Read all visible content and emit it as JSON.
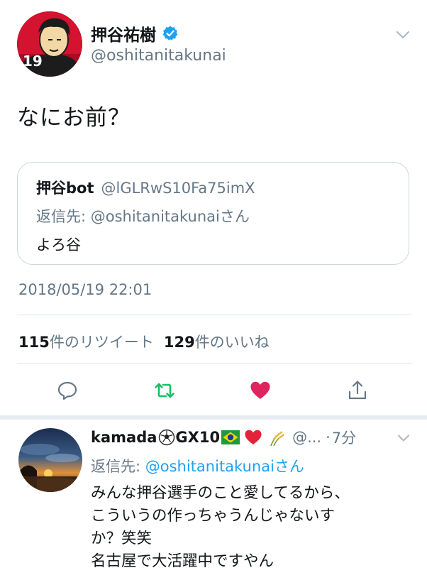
{
  "tweet": {
    "display_name": "押谷祐樹",
    "handle": "@oshitanitakunai",
    "avatar_number": "19",
    "text": "なにお前？",
    "timestamp": "2018/05/19 22:01"
  },
  "quote": {
    "name": "押谷bot",
    "handle": "@lGLRwS10Fa75imX",
    "reply_to": "返信先: @oshitanitakunaiさん",
    "text": "よろ谷"
  },
  "stats": {
    "retweets_count": "115",
    "retweets_label": "件のリツイート",
    "likes_count": "129",
    "likes_label": "件のいいね"
  },
  "actions": {
    "retweet_color": "#17bf63",
    "like_color": "#e0245e",
    "icon_color": "#657786",
    "icons": [
      "reply-icon",
      "retweet-icon",
      "like-icon",
      "share-icon"
    ]
  },
  "reply": {
    "name": "kamada",
    "name_suffix": "GX10",
    "handle": "@...",
    "separator": "·",
    "time": "7分",
    "reply_prefix": "返信先: ",
    "reply_mention": "@oshitanitakunai",
    "reply_suffix": "さん",
    "body_lines": [
      "みんな押谷選手のこと愛してるから、",
      "こういうの作っちゃうんじゃないす",
      "か？笑笑",
      "名古屋で大活躍中ですやん"
    ]
  },
  "colors": {
    "accent": "#1da1f2",
    "text": "#14171a",
    "secondary": "#657786",
    "border": "#e1e8ed"
  }
}
